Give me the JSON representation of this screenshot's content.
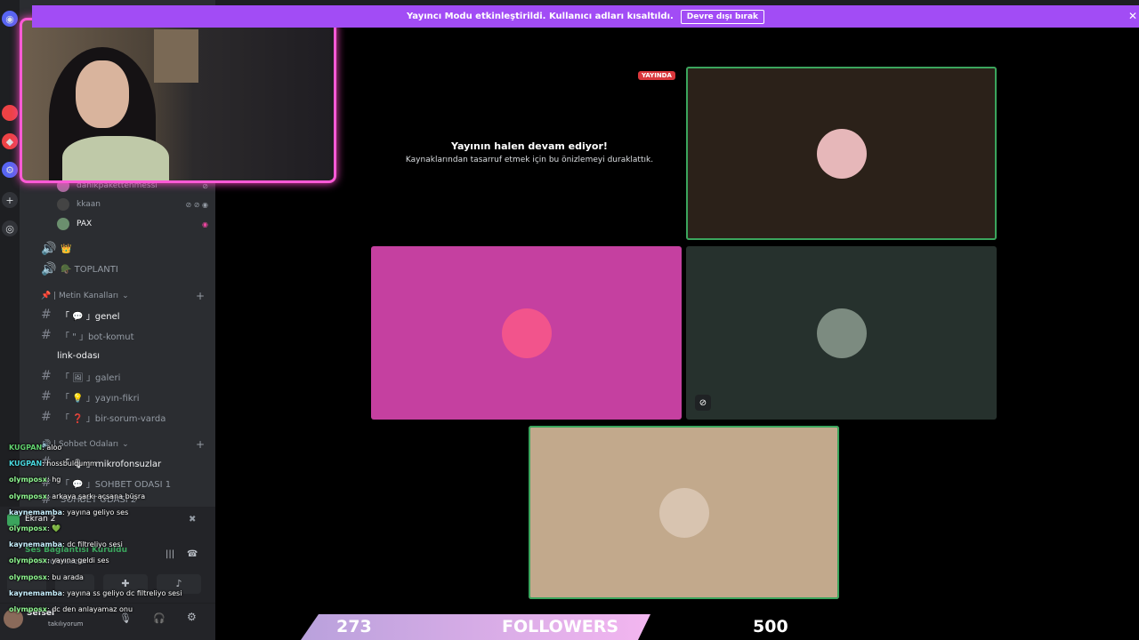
{
  "banner": {
    "text": "Yayıncı Modu etkinleştirildi. Kullanıcı adları kısaltıldı.",
    "button": "Devre dışı bırak",
    "close": "✕"
  },
  "rail": {
    "icons": [
      "discord-logo",
      "server",
      "server",
      "server",
      "active-server",
      "add-server",
      "discover"
    ]
  },
  "sidebar": {
    "voice_users": [
      {
        "name": "danikpakettenmessi",
        "icons": "⊘"
      },
      {
        "name": "kkaan",
        "icons": "⊘ ⊘ ◉"
      },
      {
        "name": "PAX",
        "icons": "◉"
      }
    ],
    "voice_channels": [
      {
        "icon": "🔊",
        "label": "👑"
      },
      {
        "icon": "🔊",
        "label": "🪖 TOPLANTI"
      }
    ],
    "text_category": "📌 | Metin Kanalları",
    "text_channels": [
      {
        "label": "「 💬 」genel",
        "active": true
      },
      {
        "label": "「 \" 」bot-komut",
        "active": false
      },
      {
        "label": "link-odası",
        "active": true
      },
      {
        "label": "「 🖼 」galeri",
        "active": false
      },
      {
        "label": "「 💡 」yayın-fikri",
        "active": false
      },
      {
        "label": "「 ❓ 」bir-sorum-varda",
        "active": false
      }
    ],
    "voice_category": "🔊 | Sohbet Odaları",
    "voice_rooms": [
      {
        "label": "「 🎙 」mikrofonsuzlar"
      },
      {
        "label": "「 💬 」SOHBET ODASI 1"
      },
      {
        "label": "SOHBET ODASI 2"
      }
    ]
  },
  "voice_panel": {
    "screen": "Ekran 2",
    "status": "Ses Bağlantısı Kuruldu",
    "channel": "「 mikrofonsuzlar"
  },
  "user_panel": {
    "name": "Sefsel",
    "status": "takılıyorum"
  },
  "chat": [
    {
      "name": "KUGPAN",
      "color": "#62d26f",
      "text": "aloo"
    },
    {
      "name": "KUGPAN",
      "color": "#4ad9e0",
      "text": "hossbuldumm"
    },
    {
      "name": "olymposx",
      "color": "#8ef58f",
      "text": "hg"
    },
    {
      "name": "olymposx",
      "color": "#8ef58f",
      "text": "arkaya şarkı açsana büşra"
    },
    {
      "name": "kaynemamba",
      "color": "#c8f0ff",
      "text": "yayına geliyo ses"
    },
    {
      "name": "olymposx",
      "color": "#8ef58f",
      "text": "💚"
    },
    {
      "name": "kaynemamba",
      "color": "#c8f0ff",
      "text": "dc filtreliyo sesi"
    },
    {
      "name": "olymposx",
      "color": "#8ef58f",
      "text": "yayına geldi ses"
    },
    {
      "name": "olymposx",
      "color": "#8ef58f",
      "text": "bu arada"
    },
    {
      "name": "kaynemamba",
      "color": "#c8f0ff",
      "text": "yayına ss geliyo dc filtreliyo sesi"
    },
    {
      "name": "olymposx",
      "color": "#8ef58f",
      "text": "dc den anlayamaz onu"
    }
  ],
  "stage": {
    "live_badge": "YAYINDA",
    "paused_title": "Yayının halen devam ediyor!",
    "paused_sub": "Kaynaklarından tasarruf etmek için bu önizlemeyi duraklattık.",
    "tiles": [
      {
        "bg": "#2b2119",
        "avatar": "#e6b7b9",
        "speaking": true
      },
      {
        "bg": "#c540a0",
        "avatar": "#f2548c",
        "speaking": false
      },
      {
        "bg": "#26312d",
        "avatar": "#7c8b80",
        "speaking": false,
        "muted_icon": "⊘"
      },
      {
        "bg": "#c2a98c",
        "avatar": "#d8c4b0",
        "speaking": true
      }
    ]
  },
  "followers": {
    "current": "273",
    "label": "FOLLOWERS",
    "goal": "500",
    "progress": 0.546
  }
}
